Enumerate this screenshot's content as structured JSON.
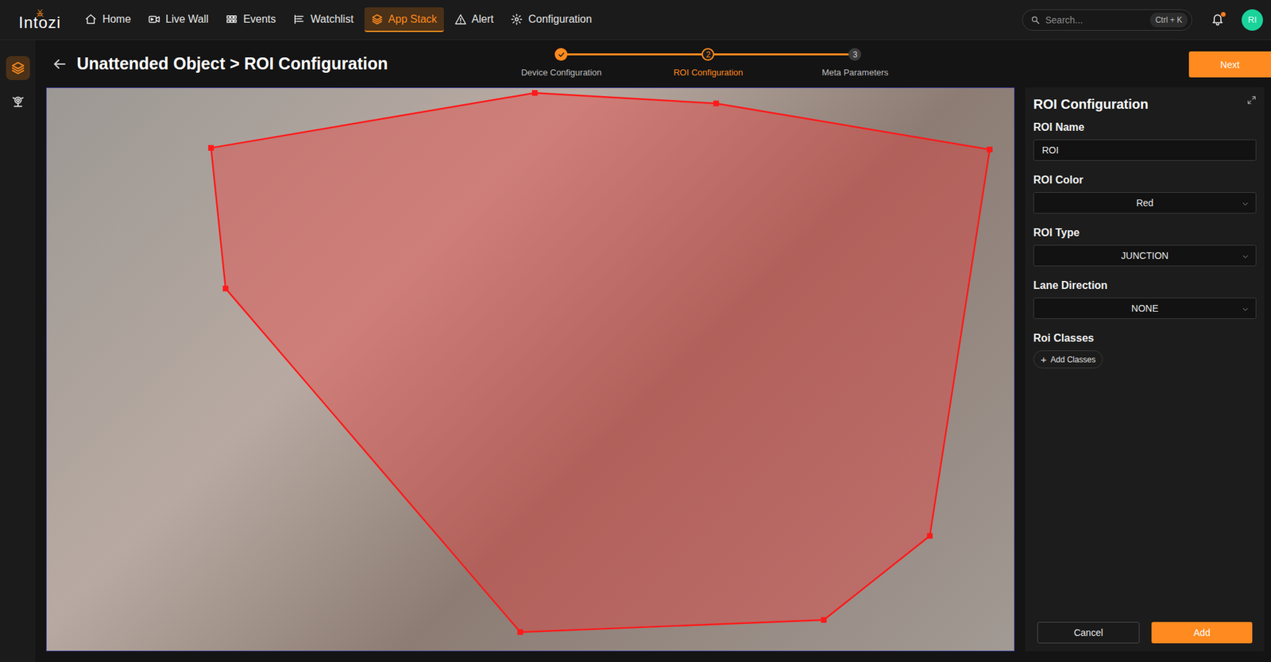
{
  "app": {
    "logo": "Intozi"
  },
  "nav": [
    {
      "label": "Home",
      "icon": "home",
      "selected": false
    },
    {
      "label": "Live Wall",
      "icon": "video",
      "selected": false
    },
    {
      "label": "Events",
      "icon": "grid",
      "selected": false
    },
    {
      "label": "Watchlist",
      "icon": "list",
      "selected": false
    },
    {
      "label": "App Stack",
      "icon": "layers",
      "selected": true
    },
    {
      "label": "Alert",
      "icon": "alert",
      "selected": false
    },
    {
      "label": "Configuration",
      "icon": "gear",
      "selected": false
    }
  ],
  "search": {
    "placeholder": "Search...",
    "shortcut": "Ctrl + K"
  },
  "notifications": {
    "unread": true
  },
  "user": {
    "initials": "RI"
  },
  "sidebar": [
    {
      "icon": "layers",
      "selected": true
    },
    {
      "icon": "camera",
      "selected": false
    }
  ],
  "page": {
    "title": "Unattended Object > ROI Configuration"
  },
  "stepper": [
    {
      "label": "Device Configuration",
      "completed": true,
      "selected": false
    },
    {
      "number": "2",
      "label": "ROI Configuration",
      "completed": false,
      "selected": true
    },
    {
      "number": "3",
      "label": "Meta Parameters",
      "completed": false,
      "selected": false
    }
  ],
  "next_button": "Next",
  "panel": {
    "title": "ROI Configuration",
    "fields": [
      {
        "kind": "input",
        "label": "ROI Name",
        "value": "ROI"
      },
      {
        "kind": "select",
        "label": "ROI Color",
        "value": "Red"
      },
      {
        "kind": "select",
        "label": "ROI Type",
        "value": "JUNCTION"
      },
      {
        "kind": "select",
        "label": "Lane Direction",
        "value": "NONE"
      },
      {
        "kind": "chips",
        "label": "Roi Classes",
        "icon": "+",
        "action": "Add Classes"
      }
    ]
  },
  "buttons": [
    {
      "label": "Cancel",
      "kind": "secondary"
    },
    {
      "label": "Add",
      "kind": "primary"
    }
  ]
}
